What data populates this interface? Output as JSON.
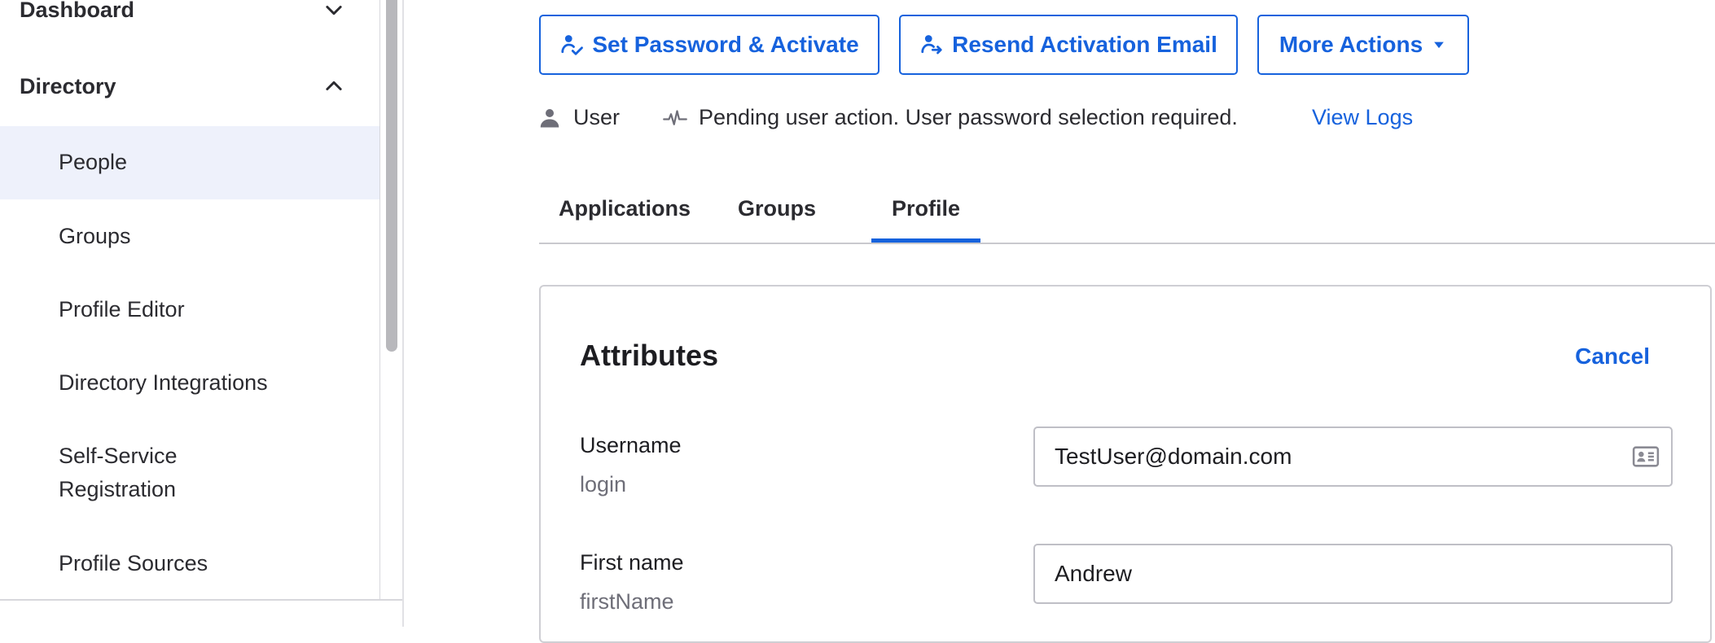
{
  "sidebar": {
    "sections": [
      {
        "label": "Dashboard",
        "expanded": false,
        "icon": "chevron-down-icon"
      },
      {
        "label": "Directory",
        "expanded": true,
        "icon": "chevron-up-icon"
      }
    ],
    "items": [
      {
        "label": "People",
        "active": true
      },
      {
        "label": "Groups"
      },
      {
        "label": "Profile Editor"
      },
      {
        "label": "Directory Integrations"
      },
      {
        "label": "Self-Service Registration"
      },
      {
        "label": "Profile Sources"
      }
    ]
  },
  "actions": {
    "set_password": {
      "label": "Set Password & Activate",
      "icon": "user-check-icon"
    },
    "resend": {
      "label": "Resend Activation Email",
      "icon": "user-arrow-icon"
    },
    "more": {
      "label": "More Actions",
      "icon": "caret-down-icon"
    }
  },
  "status": {
    "user_type": "User",
    "user_icon": "user-icon",
    "message": "Pending user action. User password selection required.",
    "message_icon": "activity-icon",
    "view_logs": "View Logs"
  },
  "tabs": [
    {
      "label": "Applications",
      "active": false
    },
    {
      "label": "Groups",
      "active": false
    },
    {
      "label": "Profile",
      "active": true
    }
  ],
  "attributes": {
    "title": "Attributes",
    "cancel": "Cancel",
    "fields": [
      {
        "label": "Username",
        "key": "login",
        "value": "TestUser@domain.com",
        "icon": "contact-card-icon"
      },
      {
        "label": "First name",
        "key": "firstName",
        "value": "Andrew"
      }
    ]
  },
  "colors": {
    "accent": "#1662dd",
    "active_nav_bg": "#eef1fb"
  }
}
